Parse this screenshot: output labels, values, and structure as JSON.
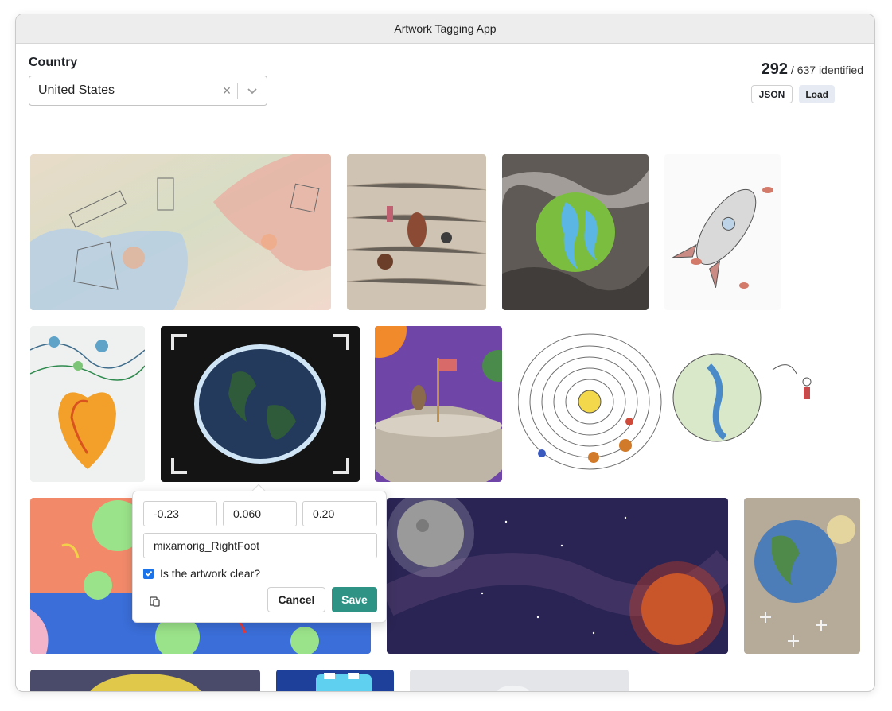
{
  "window": {
    "title": "Artwork Tagging App"
  },
  "filter": {
    "label": "Country",
    "selected": "United States",
    "clear_glyph": "×",
    "icons": [
      "clear-icon",
      "chevron-down-icon"
    ]
  },
  "progress": {
    "identified": "292",
    "total_text": "/ 637 identified",
    "json_label": "JSON",
    "load_label": "Load"
  },
  "gallery": {
    "artworks": [
      "abstract-geometric-pastel",
      "pencil-figures-on-brown",
      "earth-on-marbled-black",
      "rocket-sketch",
      "anatomical-heart-with-planets",
      "earth-in-chalk-on-black",
      "astronaut-on-moon-purple",
      "solar-system-pencil-drawing",
      "colorful-bubbles-abstract",
      "moon-and-red-planet-space",
      "earth-collage",
      "yellow-sun-painting",
      "blue-comic-drawing",
      "gray-faded-artwork"
    ]
  },
  "editor": {
    "x": "-0.23",
    "y": "0.060",
    "z": "0.20",
    "bone": "mixamorig_RightFoot",
    "clear_question": "Is the artwork clear?",
    "clear_checked": true,
    "cancel_label": "Cancel",
    "save_label": "Save",
    "accent_color": "#2e9385"
  }
}
